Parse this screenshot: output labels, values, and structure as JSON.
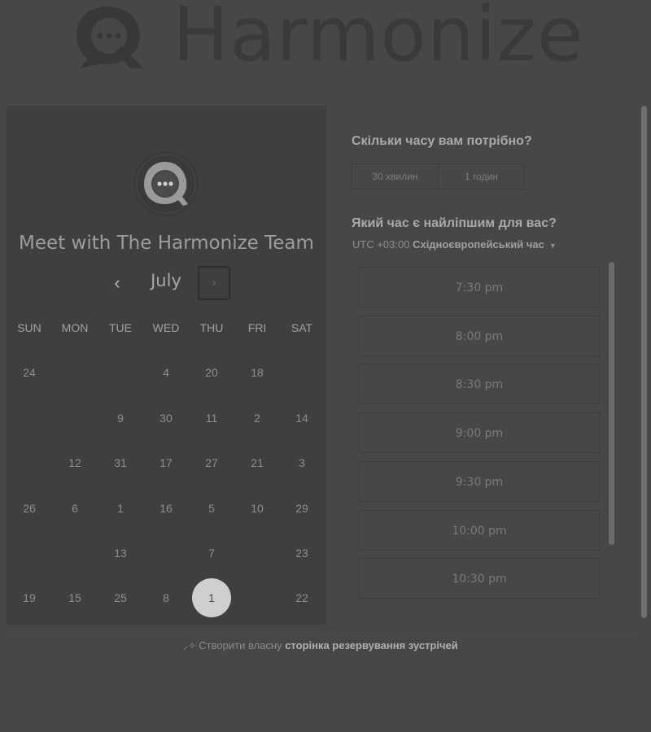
{
  "brand": {
    "name": "Harmonize"
  },
  "calendar": {
    "title": "Meet with The Harmonize Team",
    "month": "July",
    "prev_symbol": "‹",
    "next_symbol": "›",
    "weekdays": [
      "SUN",
      "MON",
      "TUE",
      "WED",
      "THU",
      "FRI",
      "SAT"
    ],
    "rows": [
      [
        "24",
        "",
        "",
        "4",
        "20",
        "18",
        ""
      ],
      [
        "",
        "",
        "9",
        "30",
        "11",
        "2",
        "14"
      ],
      [
        "",
        "12",
        "31",
        "17",
        "27",
        "21",
        "3"
      ],
      [
        "26",
        "6",
        "1",
        "16",
        "5",
        "10",
        "29"
      ],
      [
        "",
        "",
        "13",
        "",
        "7",
        "",
        "23"
      ],
      [
        "19",
        "15",
        "25",
        "8",
        "1",
        "",
        "22"
      ]
    ],
    "selected_day": "1"
  },
  "duration": {
    "label": "Скільки часу вам потрібно?",
    "options": [
      "30 хвилин",
      "1 годин"
    ]
  },
  "times": {
    "label": "Який час є найліпшим для вас?",
    "tz_offset": "UTC +03:00",
    "tz_name": "Східноєвропейський час",
    "slots": [
      "7:30 pm",
      "8:00 pm",
      "8:30 pm",
      "9:00 pm",
      "9:30 pm",
      "10:00 pm",
      "10:30 pm"
    ]
  },
  "footer": {
    "prefix": "Створити власну",
    "link": "сторінка резервування зустрічей"
  }
}
